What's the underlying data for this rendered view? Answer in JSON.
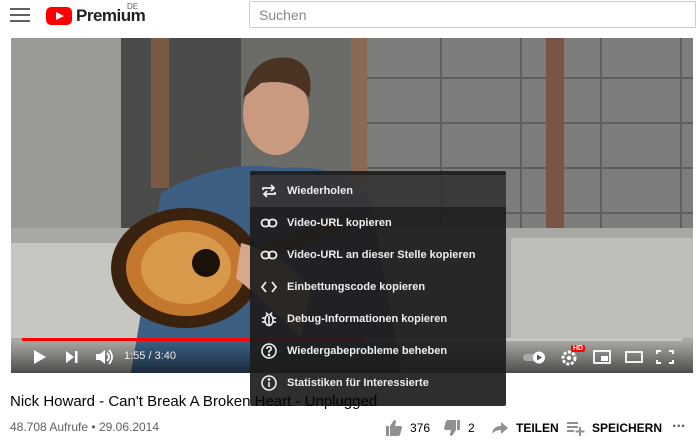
{
  "header": {
    "logo_text": "Premium",
    "logo_region": "DE",
    "search_placeholder": "Suchen"
  },
  "player": {
    "time_current": "1:55",
    "time_separator": "/",
    "time_total": "3:40",
    "progress_fraction": 0.52,
    "quality_badge": "HD"
  },
  "context_menu": {
    "items": [
      {
        "label": "Wiederholen",
        "icon": "loop-icon"
      },
      {
        "label": "Video-URL kopieren",
        "icon": "link-icon"
      },
      {
        "label": "Video-URL an dieser Stelle kopieren",
        "icon": "link-icon"
      },
      {
        "label": "Einbettungscode kopieren",
        "icon": "code-icon"
      },
      {
        "label": "Debug-Informationen kopieren",
        "icon": "bug-icon"
      },
      {
        "label": "Wiedergabeprobleme beheben",
        "icon": "help-icon"
      },
      {
        "label": "Statistiken für Interessierte",
        "icon": "info-icon"
      }
    ]
  },
  "video": {
    "title": "Nick Howard - Can't Break A Broken Heart - Unplugged",
    "views": "48.708 Aufrufe",
    "dot": "•",
    "date": "29.06.2014"
  },
  "actions": {
    "like_count": "376",
    "dislike_count": "2",
    "share_label": "TEILEN",
    "save_label": "SPEICHERN",
    "more_label": "..."
  }
}
